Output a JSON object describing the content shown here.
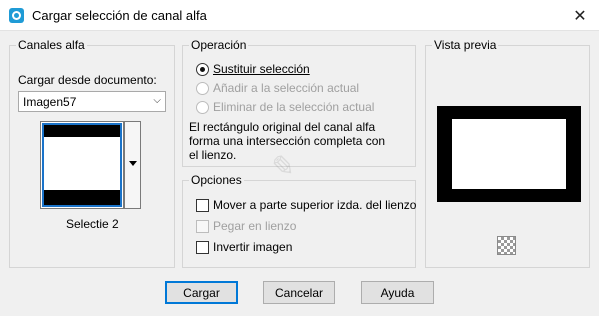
{
  "window": {
    "title": "Cargar selección de canal alfa",
    "close_glyph": "✕"
  },
  "canales": {
    "legend": "Canales alfa",
    "doc_label": "Cargar desde documento:",
    "doc_value": "Imagen57",
    "channel_name": "Selectie 2"
  },
  "operacion": {
    "legend": "Operación",
    "options": [
      {
        "label": "Sustituir selección",
        "selected": true,
        "enabled": true
      },
      {
        "label": "Añadir a la selección actual",
        "selected": false,
        "enabled": false
      },
      {
        "label": "Eliminar de la selección actual",
        "selected": false,
        "enabled": false
      }
    ],
    "description": "El rectángulo original del canal alfa forma una intersección completa con el lienzo."
  },
  "opciones": {
    "legend": "Opciones",
    "checks": [
      {
        "label": "Mover a parte superior izda. del lienzo",
        "checked": false,
        "enabled": true
      },
      {
        "label": "Pegar en lienzo",
        "checked": false,
        "enabled": false
      },
      {
        "label": "Invertir imagen",
        "checked": false,
        "enabled": true
      }
    ]
  },
  "preview": {
    "legend": "Vista previa"
  },
  "buttons": {
    "load": "Cargar",
    "cancel": "Cancelar",
    "help": "Ayuda"
  },
  "colors": {
    "accent": "#0078d7",
    "title_icon": "#1f9bd6"
  },
  "icons": {
    "app": "psp-app-icon",
    "close": "close-icon",
    "dropdown": "chevron-down-icon",
    "zoom": "checker-zoom-icon"
  }
}
